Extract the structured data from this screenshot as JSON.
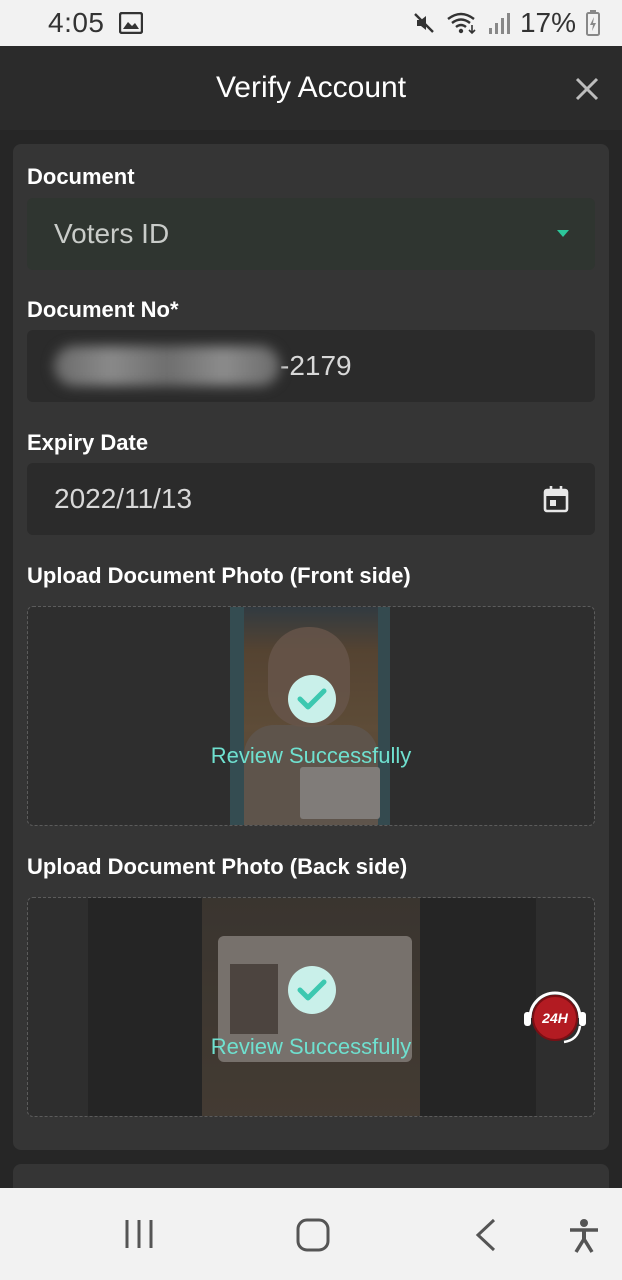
{
  "status_bar": {
    "time": "4:05",
    "battery": "17%"
  },
  "header": {
    "title": "Verify Account"
  },
  "form": {
    "document_label": "Document",
    "document_value": "Voters ID",
    "document_no_label": "Document No*",
    "document_no_suffix": "-2179",
    "expiry_label": "Expiry Date",
    "expiry_value": "2022/11/13",
    "front_label": "Upload Document Photo (Front side)",
    "front_status": "Review Successfully",
    "back_label": "Upload Document Photo (Back side)",
    "back_status": "Review Successfully"
  },
  "support": {
    "badge_text": "24H"
  },
  "colors": {
    "accent": "#2cc79a",
    "review_text": "#6fe0cf",
    "support_red": "#b31b22"
  },
  "icons": [
    "image-icon",
    "mute-icon",
    "wifi-icon",
    "signal-icon",
    "battery-icon",
    "close-icon",
    "dropdown-arrow-icon",
    "calendar-icon",
    "check-icon",
    "headset-support-icon",
    "recent-apps-icon",
    "home-icon",
    "back-icon",
    "accessibility-icon"
  ]
}
